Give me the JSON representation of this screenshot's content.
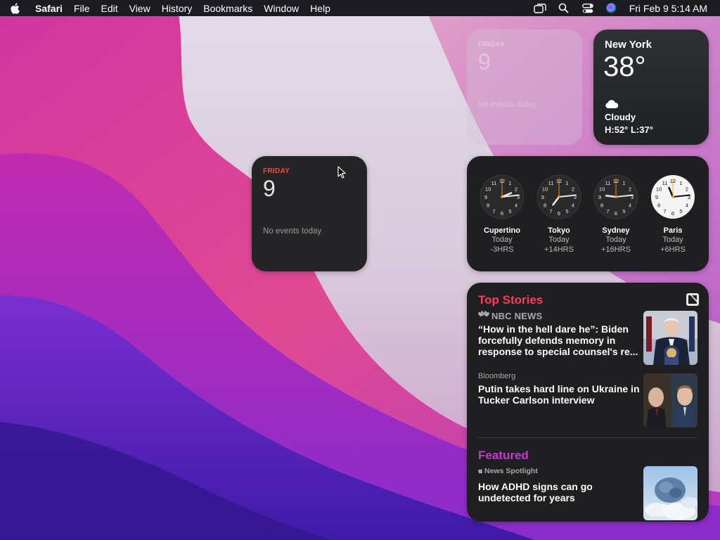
{
  "menubar": {
    "app_name": "Safari",
    "menus": [
      "File",
      "Edit",
      "View",
      "History",
      "Bookmarks",
      "Window",
      "Help"
    ],
    "datetime": "Fri Feb 9  5:14 AM",
    "status_icons": [
      "window-switcher-icon",
      "search-icon",
      "control-center-icon",
      "siri-icon"
    ]
  },
  "calendar_ghost": {
    "day": "FRIDAY",
    "date": "9",
    "events": "No events today"
  },
  "calendar": {
    "day": "FRIDAY",
    "date": "9",
    "events": "No events today"
  },
  "weather": {
    "city": "New York",
    "temp": "38°",
    "condition": "Cloudy",
    "range": "H:52° L:37°",
    "icon": "cloud-icon"
  },
  "world_clock": {
    "clocks": [
      {
        "city": "Cupertino",
        "day": "Today",
        "offset": "-3HRS",
        "hour": 2,
        "minute": 14,
        "light": false
      },
      {
        "city": "Tokyo",
        "day": "Today",
        "offset": "+14HRS",
        "hour": 7,
        "minute": 14,
        "light": false
      },
      {
        "city": "Sydney",
        "day": "Today",
        "offset": "+16HRS",
        "hour": 9,
        "minute": 14,
        "light": false
      },
      {
        "city": "Paris",
        "day": "Today",
        "offset": "+6HRS",
        "hour": 11,
        "minute": 14,
        "light": true
      }
    ]
  },
  "news": {
    "top_title": "Top Stories",
    "stories": [
      {
        "source": "NBC NEWS",
        "headline_lines": [
          "“How in the hell dare he”: Biden",
          "forcefully defends memory in",
          "response to special counsel's re..."
        ]
      },
      {
        "source": "Bloomberg",
        "headline_lines": [
          "Putin takes hard line on Ukraine in",
          "Tucker Carlson interview"
        ]
      }
    ],
    "featured_title": "Featured",
    "featured": {
      "source": "News Spotlight",
      "headline_lines": [
        "How ADHD signs can go",
        "undetected for years"
      ]
    }
  }
}
